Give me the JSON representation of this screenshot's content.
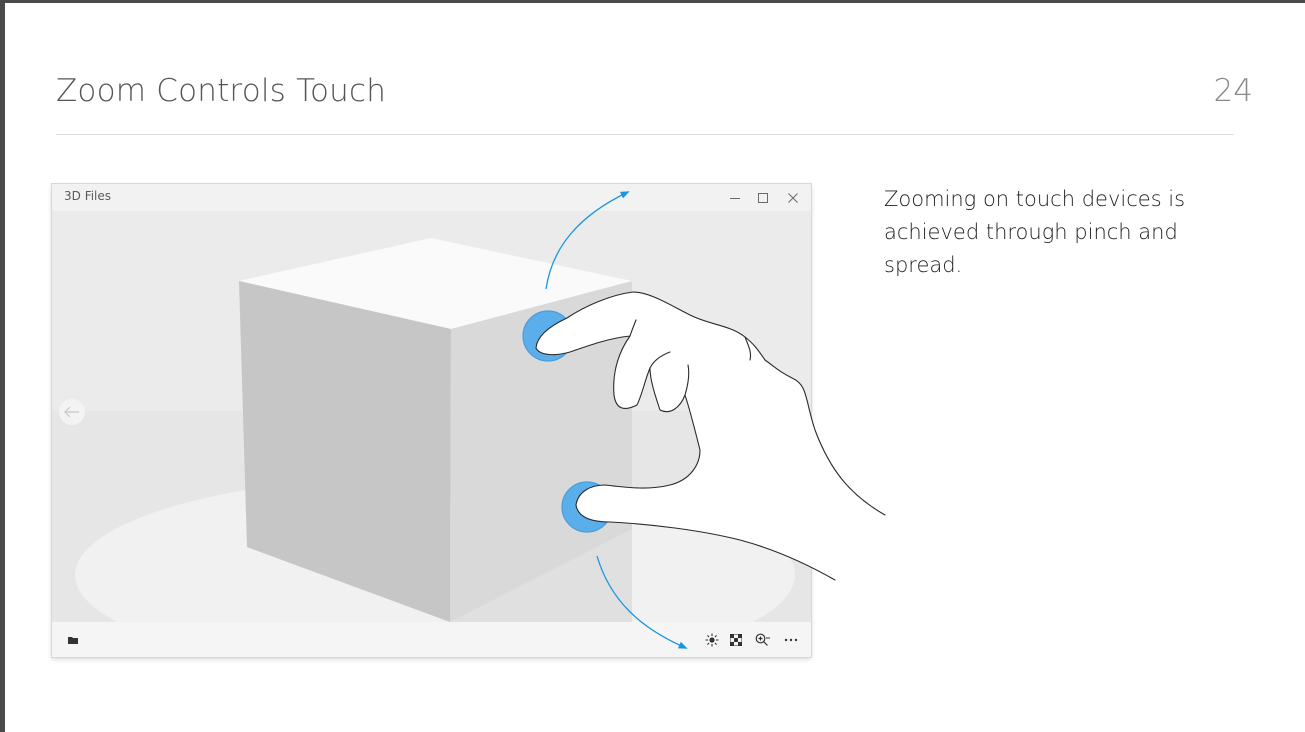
{
  "slide": {
    "title": "Zoom Controls Touch",
    "page_number": "24",
    "description": "Zooming on touch devices is achieved through pinch and spread."
  },
  "window": {
    "title": "3D Files",
    "minimize_icon": "minimize-icon",
    "maximize_icon": "maximize-icon",
    "close_icon": "close-icon"
  },
  "viewport": {
    "back_icon": "back-arrow-icon",
    "object": "cube"
  },
  "appbar": {
    "left_icon": "folder-icon",
    "right_icons": [
      "lighting-icon",
      "texture-icon",
      "zoom-icon",
      "more-icon"
    ]
  },
  "gesture": {
    "type": "pinch-spread",
    "touch_color": "#5aaeea",
    "arrow_color": "#1a95e0"
  }
}
